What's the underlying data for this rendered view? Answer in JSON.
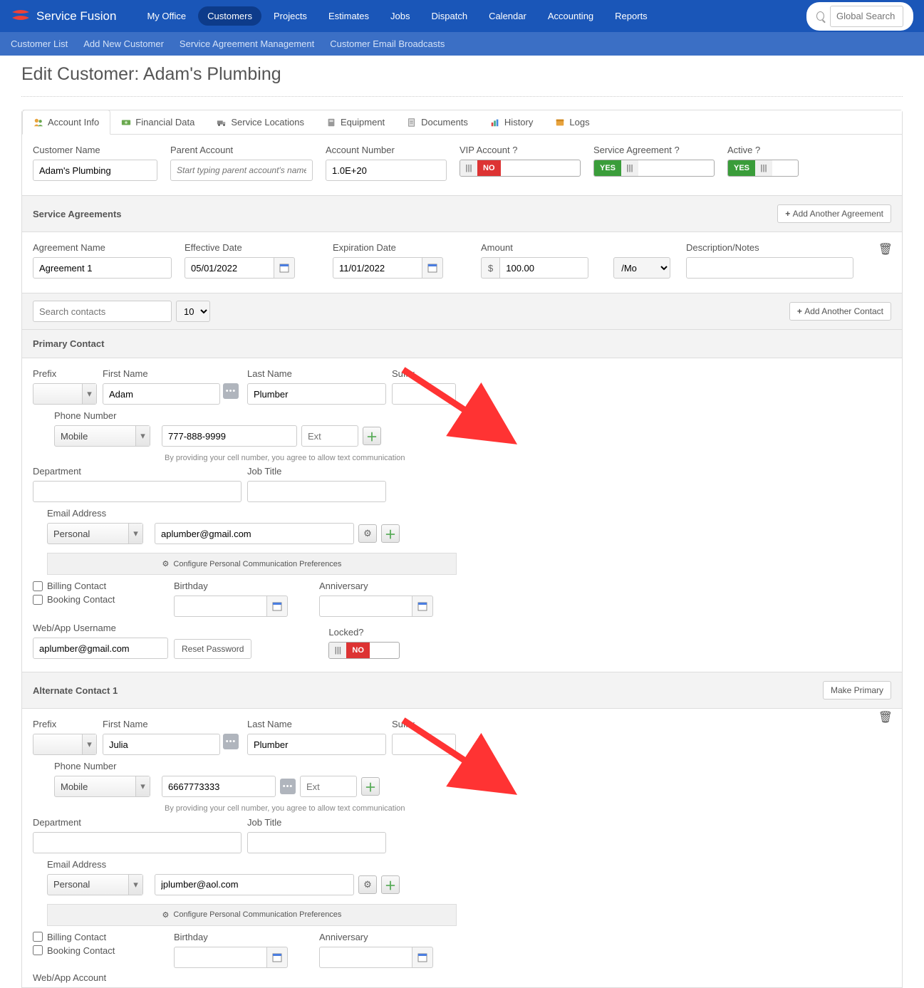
{
  "brand": "Service Fusion",
  "nav": {
    "items": [
      "My Office",
      "Customers",
      "Projects",
      "Estimates",
      "Jobs",
      "Dispatch",
      "Calendar",
      "Accounting",
      "Reports"
    ],
    "active": "Customers",
    "search_placeholder": "Global Search"
  },
  "subnav": [
    "Customer List",
    "Add New Customer",
    "Service Agreement Management",
    "Customer Email Broadcasts"
  ],
  "page_title": "Edit Customer: Adam's Plumbing",
  "tabs": [
    "Account Info",
    "Financial Data",
    "Service Locations",
    "Equipment",
    "Documents",
    "History",
    "Logs"
  ],
  "active_tab": "Account Info",
  "top_fields": {
    "customer_name_label": "Customer Name",
    "customer_name": "Adam's Plumbing",
    "parent_label": "Parent Account",
    "parent_placeholder": "Start typing parent account's name...",
    "account_number_label": "Account Number",
    "account_number": "1.0E+20",
    "vip_label": "VIP Account ?",
    "vip_value": "NO",
    "sa_label": "Service Agreement ?",
    "sa_value": "YES",
    "active_label": "Active ?",
    "active_value": "YES"
  },
  "agreements": {
    "header": "Service Agreements",
    "add_button": "Add Another Agreement",
    "name_label": "Agreement Name",
    "name_value": "Agreement 1",
    "eff_label": "Effective Date",
    "eff_value": "05/01/2022",
    "exp_label": "Expiration Date",
    "exp_value": "11/01/2022",
    "amount_label": "Amount",
    "amount_prefix": "$",
    "amount_value": "100.00",
    "amount_period": "/Mo",
    "desc_label": "Description/Notes"
  },
  "contacts_toolbar": {
    "search_placeholder": "Search contacts",
    "page_size": "10",
    "add_button": "Add Another Contact"
  },
  "primary": {
    "header": "Primary Contact",
    "prefix_label": "Prefix",
    "first_label": "First Name",
    "first_value": "Adam",
    "last_label": "Last Name",
    "last_value": "Plumber",
    "suffix_label": "Suffix",
    "dept_label": "Department",
    "job_label": "Job Title",
    "phone_label": "Phone Number",
    "phone_type": "Mobile",
    "phone_value": "777-888-9999",
    "ext_placeholder": "Ext",
    "phone_hint": "By providing your cell number, you agree to allow text communication",
    "email_label": "Email Address",
    "email_type": "Personal",
    "email_value": "aplumber@gmail.com",
    "config_label": "Configure Personal Communication Preferences",
    "billing_label": "Billing Contact",
    "booking_label": "Booking Contact",
    "bday_label": "Birthday",
    "anniv_label": "Anniversary",
    "webuser_label": "Web/App Username",
    "webuser_value": "aplumber@gmail.com",
    "reset_label": "Reset Password",
    "locked_label": "Locked?",
    "locked_value": "NO"
  },
  "alt1": {
    "header": "Alternate Contact 1",
    "make_primary": "Make Primary",
    "prefix_label": "Prefix",
    "first_label": "First Name",
    "first_value": "Julia",
    "last_label": "Last Name",
    "last_value": "Plumber",
    "suffix_label": "Suffix",
    "dept_label": "Department",
    "job_label": "Job Title",
    "phone_label": "Phone Number",
    "phone_type": "Mobile",
    "phone_value": "6667773333",
    "ext_placeholder": "Ext",
    "phone_hint": "By providing your cell number, you agree to allow text communication",
    "email_label": "Email Address",
    "email_type": "Personal",
    "email_value": "jplumber@aol.com",
    "config_label": "Configure Personal Communication Preferences",
    "billing_label": "Billing Contact",
    "booking_label": "Booking Contact",
    "bday_label": "Birthday",
    "anniv_label": "Anniversary",
    "webapp_label": "Web/App Account"
  }
}
